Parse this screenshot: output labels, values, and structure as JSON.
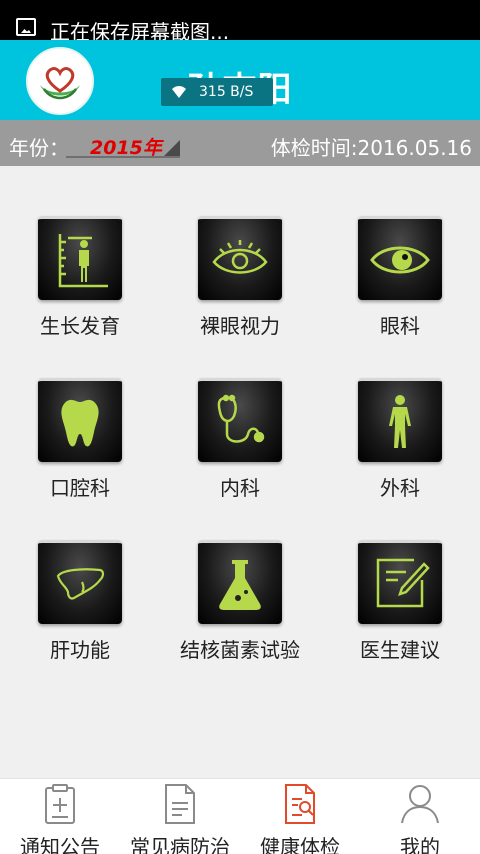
{
  "status_bar": {
    "notification_text": "正在保存屏幕截图...",
    "notification_icon": "screenshot-icon"
  },
  "header": {
    "name": "孙志阳",
    "network_speed": "315 B/S",
    "logo_icon": "heart-hands-logo"
  },
  "year_bar": {
    "year_label": "年份：",
    "year_value": "2015年",
    "exam_time": "体检时间:2016.05.16"
  },
  "categories": [
    {
      "label": "生长发育",
      "icon": "height-measure-icon"
    },
    {
      "label": "裸眼视力",
      "icon": "eye-outline-icon"
    },
    {
      "label": "眼科",
      "icon": "eye-icon"
    },
    {
      "label": "口腔科",
      "icon": "tooth-icon"
    },
    {
      "label": "内科",
      "icon": "stethoscope-icon"
    },
    {
      "label": "外科",
      "icon": "human-body-icon"
    },
    {
      "label": "肝功能",
      "icon": "liver-icon"
    },
    {
      "label": "结核菌素试验",
      "icon": "flask-icon"
    },
    {
      "label": "医生建议",
      "icon": "edit-note-icon"
    }
  ],
  "tabs": [
    {
      "label": "通知公告",
      "icon": "clipboard-icon",
      "active": false
    },
    {
      "label": "常见病防治",
      "icon": "document-icon",
      "active": false
    },
    {
      "label": "健康体检",
      "icon": "checkup-icon",
      "active": true
    },
    {
      "label": "我的",
      "icon": "user-icon",
      "active": false
    }
  ],
  "colors": {
    "header": "#00c4de",
    "icon_green": "#b5d94a",
    "year_red": "#e00000",
    "active_tab": "#e24a2a"
  }
}
